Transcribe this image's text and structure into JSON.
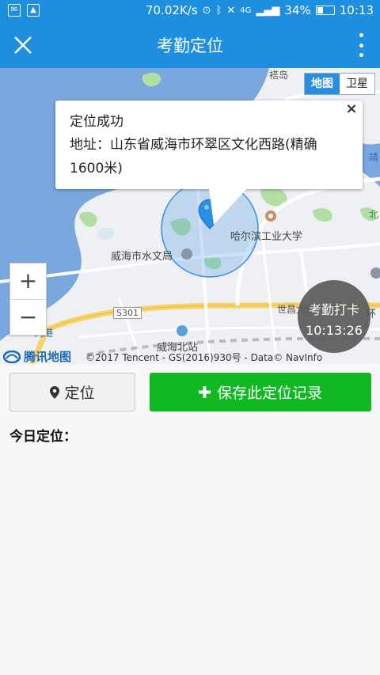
{
  "status_bar": {
    "speed": "70.02K/s",
    "network": "4G",
    "battery": "34%",
    "battery_level": 0.34,
    "time": "10:13",
    "icons": [
      "notification-icon",
      "image-icon",
      "location-icon",
      "bluetooth-icon",
      "mute-icon",
      "signal-icon",
      "battery-icon"
    ]
  },
  "app_bar": {
    "title": "考勤定位",
    "close_icon": "close-icon",
    "more_icon": "more-vertical-icon"
  },
  "map": {
    "map_type": {
      "map": "地图",
      "satellite": "卫星",
      "selected": "map"
    },
    "popup": {
      "title": "定位成功",
      "address": "地址：山东省威海市环翠区文化西路(精确1600米)"
    },
    "labels": {
      "a": "褡岛",
      "harbin_univ": "哈尔滨工业大学",
      "hydrology": "威海市水文局",
      "road": "S301",
      "world_ave": "世昌大道",
      "huan": "环",
      "station": "威海北站",
      "port": "码港",
      "jing": "靖",
      "bei": "北"
    },
    "zoom_in": "+",
    "zoom_out": "−",
    "checkin": {
      "label": "考勤打卡",
      "time": "10:13:26"
    },
    "logo": "腾讯地图",
    "copyright": "©2017 Tencent - GS(2016)930号 - Data© NavInfo",
    "colors": {
      "water": "#7aa7dd",
      "accuracy_circle": "#3a8ee0",
      "pin": "#2d8fe3"
    }
  },
  "actions": {
    "locate": "定位",
    "save": "保存此定位记录"
  },
  "today_label": "今日定位："
}
